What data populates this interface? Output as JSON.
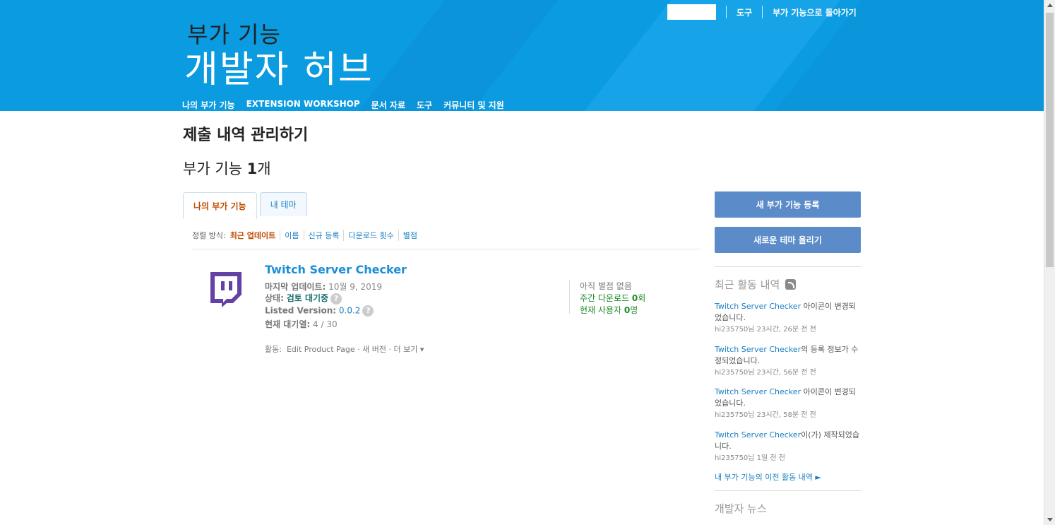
{
  "topnav": {
    "tools": "도구",
    "back": "부가 기능으로 돌아가기"
  },
  "logo": {
    "small": "부가 기능",
    "big": "개발자 허브"
  },
  "mainnav": [
    "나의 부가 기능",
    "EXTENSION WORKSHOP",
    "문서 자료",
    "도구",
    "커뮤니티 및 지원"
  ],
  "page": {
    "title": "제출 내역 관리하기",
    "count_prefix": "부가 기능 ",
    "count_num": "1",
    "count_suffix": "개"
  },
  "tabs": [
    "나의 부가 기능",
    "내 테마"
  ],
  "sort": {
    "label": "정렬 방식:",
    "items": [
      "최근 업데이트",
      "이름",
      "신규 등록",
      "다운로드 횟수",
      "별점"
    ]
  },
  "addon": {
    "name": "Twitch Server Checker",
    "updated_label": "마지막 업데이트:",
    "updated_value": "10월 9, 2019",
    "status_label": "상태:",
    "status_value": "검토 대기중",
    "version_label": "Listed Version:",
    "version_value": "0.0.2",
    "queue_label": "현재 대기열:",
    "queue_value": "4 / 30",
    "no_rating": "아직 별점 없음",
    "weekly_prefix": "주간 다운로드 ",
    "weekly_num": "0",
    "weekly_suffix": "회",
    "users_prefix": "현재 사용자 ",
    "users_num": "0",
    "users_suffix": "명",
    "actions_label": "활동:",
    "actions_items": "Edit Product Page · 새 버전 · 더 보기 ▾",
    "icon": "twitch-icon",
    "icon_color": "#6441a5"
  },
  "sidebar": {
    "new_addon_btn": "새 부가 기능 등록",
    "new_theme_btn": "새로운 테마 올리기",
    "recent_title": "최근 활동 내역",
    "activities": [
      {
        "link": "Twitch Server Checker",
        "text": " 아이콘이 변경되었습니다.",
        "time": "hi235750님 23시간, 26분 전 전"
      },
      {
        "link": "Twitch Server Checker",
        "text": "의 등록 정보가 수정되었습니다.",
        "time": "hi235750님 23시간, 56분 전 전"
      },
      {
        "link": "Twitch Server Checker",
        "text": " 아이콘이 변경되었습니다.",
        "time": "hi235750님 23시간, 58분 전 전"
      },
      {
        "link": "Twitch Server Checker",
        "text": "이(가) 제작되었습니다.",
        "time": "hi235750님 1일 전 전"
      }
    ],
    "prev_activity": "내 부가 기능의 이전 활동 내역 ►",
    "dev_news": "개발자 뉴스"
  },
  "colors": {
    "header_bg": "#0a9be0",
    "button_bg": "#5b8cc9",
    "link": "#1a7fc3",
    "active_tab": "#c04a00"
  }
}
